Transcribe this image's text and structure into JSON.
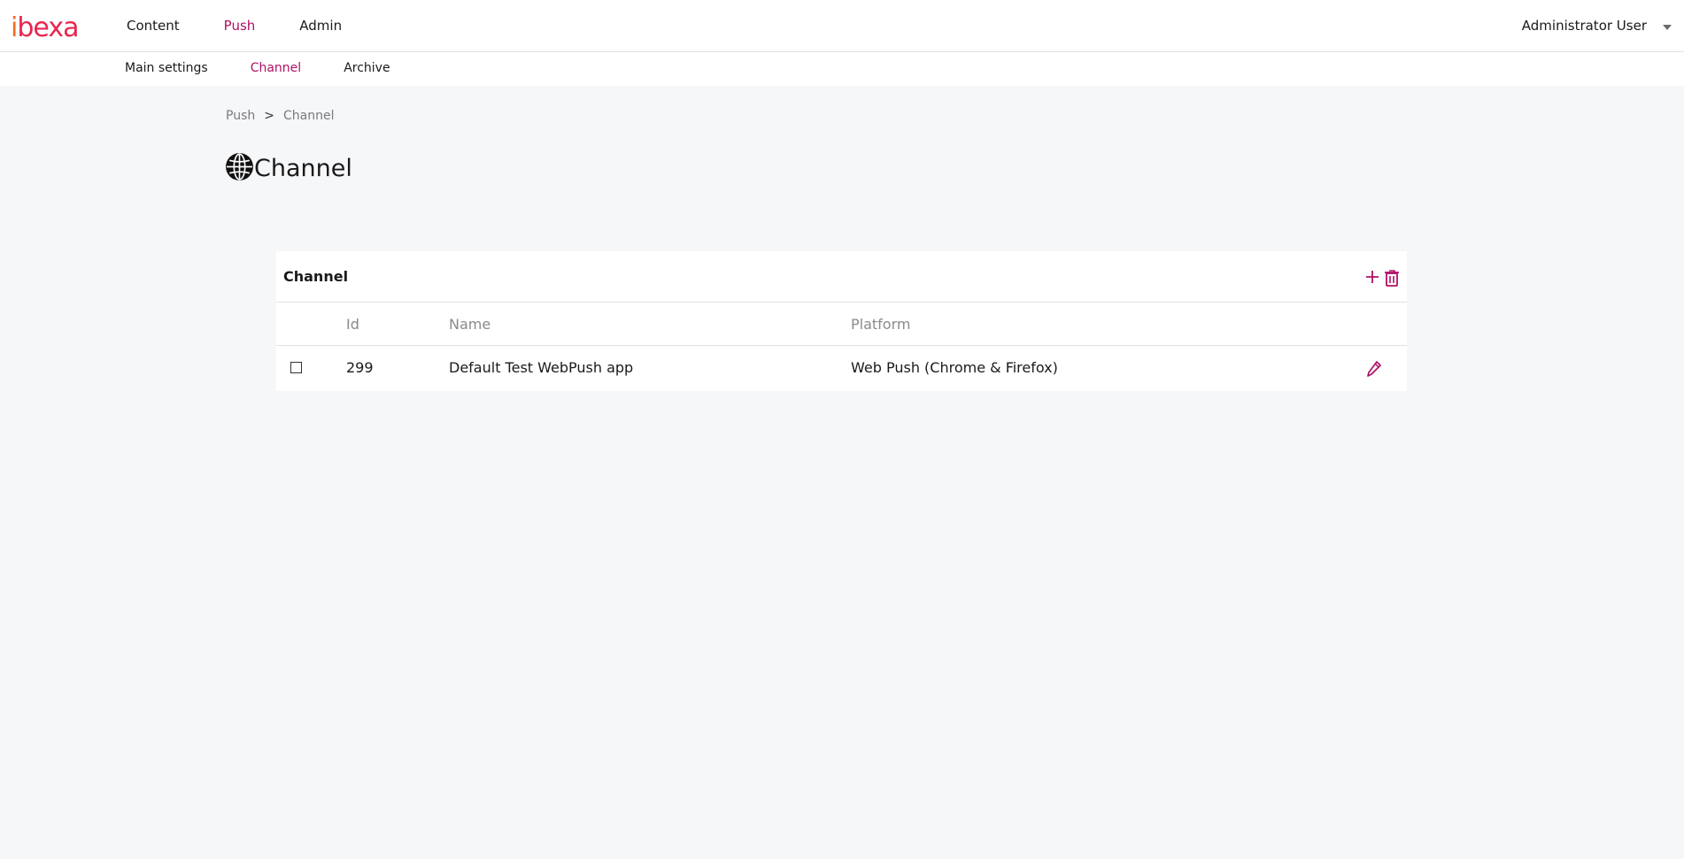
{
  "brand": {
    "logo_prefix": "i",
    "logo_rest": "bexa"
  },
  "topnav": {
    "items": [
      {
        "label": "Content",
        "active": false
      },
      {
        "label": "Push",
        "active": true
      },
      {
        "label": "Admin",
        "active": false
      }
    ],
    "user": "Administrator User"
  },
  "subnav": {
    "items": [
      {
        "label": "Main settings",
        "active": false
      },
      {
        "label": "Channel",
        "active": true
      },
      {
        "label": "Archive",
        "active": false
      }
    ]
  },
  "breadcrumb": {
    "items": [
      "Push",
      "Channel"
    ],
    "separator": ">"
  },
  "page": {
    "title": "Channel",
    "icon": "globe-icon"
  },
  "card": {
    "title": "Channel",
    "actions": [
      "add-icon",
      "trash-icon"
    ],
    "columns": [
      "",
      "Id",
      "Name",
      "Platform",
      ""
    ],
    "rows": [
      {
        "checked": false,
        "id": "299",
        "name": "Default Test WebPush app",
        "platform": "Web Push (Chrome & Firefox)"
      }
    ]
  },
  "colors": {
    "accent": "#ae1164",
    "logo_red": "#e8264e",
    "logo_orange": "#f36b21",
    "background": "#f6f7f9"
  }
}
